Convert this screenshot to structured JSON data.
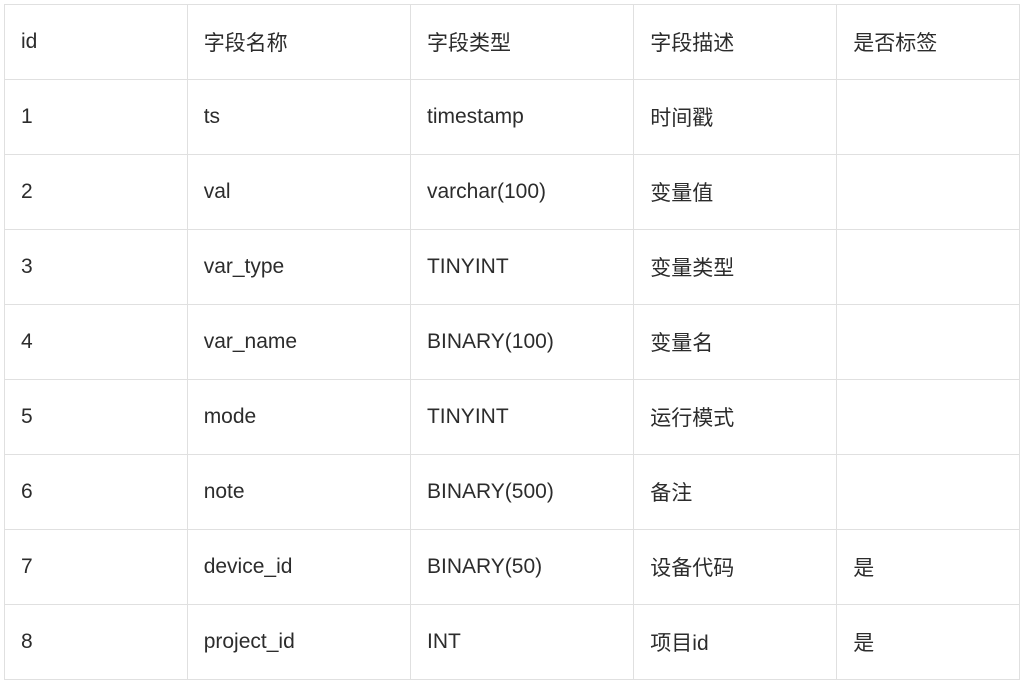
{
  "table": {
    "headers": {
      "id": "id",
      "name": "字段名称",
      "type": "字段类型",
      "desc": "字段描述",
      "tag": "是否标签"
    },
    "rows": [
      {
        "id": "1",
        "name": "ts",
        "type": "timestamp",
        "desc": "时间戳",
        "tag": ""
      },
      {
        "id": "2",
        "name": "val",
        "type": "varchar(100)",
        "desc": "变量值",
        "tag": ""
      },
      {
        "id": "3",
        "name": "var_type",
        "type": "TINYINT",
        "desc": "变量类型",
        "tag": ""
      },
      {
        "id": "4",
        "name": "var_name",
        "type": "BINARY(100)",
        "desc": "变量名",
        "tag": ""
      },
      {
        "id": "5",
        "name": "mode",
        "type": "TINYINT",
        "desc": "运行模式",
        "tag": ""
      },
      {
        "id": "6",
        "name": "note",
        "type": "BINARY(500)",
        "desc": "备注",
        "tag": ""
      },
      {
        "id": "7",
        "name": "device_id",
        "type": "BINARY(50)",
        "desc": "设备代码",
        "tag": "是"
      },
      {
        "id": "8",
        "name": "project_id",
        "type": "INT",
        "desc": "项目id",
        "tag": "是"
      }
    ]
  }
}
